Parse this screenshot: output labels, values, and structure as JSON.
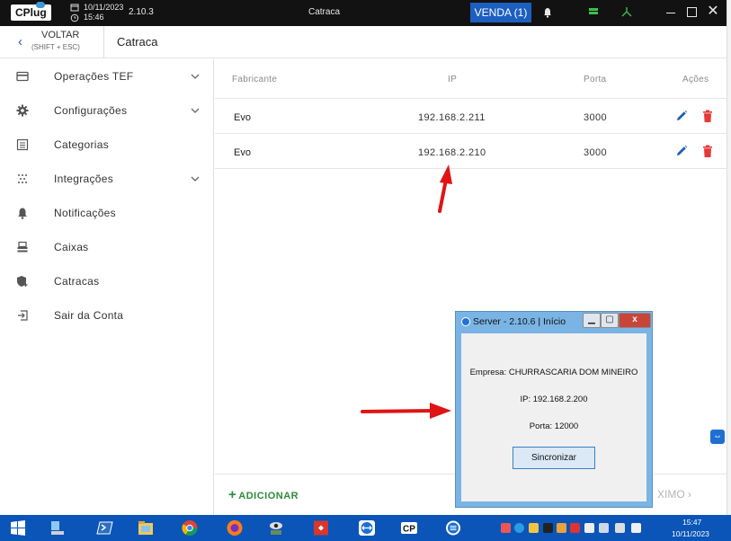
{
  "titlebar": {
    "app_name": "CPlug",
    "date": "10/11/2023",
    "time": "15:46",
    "version": "2.10.3",
    "title": "Catraca",
    "venda_label": "VENDA (1)"
  },
  "header": {
    "back_label": "VOLTAR",
    "back_shortcut": "(SHIFT + ESC)",
    "page_title": "Catraca"
  },
  "sidebar": {
    "items": [
      {
        "label": "Operações TEF",
        "icon": "card-icon",
        "expandable": true
      },
      {
        "label": "Configurações",
        "icon": "gear-icon",
        "expandable": true
      },
      {
        "label": "Categorias",
        "icon": "list-icon",
        "expandable": false
      },
      {
        "label": "Integrações",
        "icon": "dots-icon",
        "expandable": true
      },
      {
        "label": "Notificações",
        "icon": "bell-icon",
        "expandable": false
      },
      {
        "label": "Caixas",
        "icon": "register-icon",
        "expandable": false
      },
      {
        "label": "Catracas",
        "icon": "shield-plus-icon",
        "expandable": false
      },
      {
        "label": "Sair da Conta",
        "icon": "exit-icon",
        "expandable": false
      }
    ]
  },
  "table": {
    "columns": [
      "Fabricante",
      "IP",
      "Porta",
      "Ações"
    ],
    "rows": [
      {
        "fabricante": "Evo",
        "ip": "192.168.2.211",
        "porta": "3000"
      },
      {
        "fabricante": "Evo",
        "ip": "192.168.2.210",
        "porta": "3000"
      }
    ]
  },
  "footer": {
    "add_label": "ADICIONAR",
    "next_label": "XIMO ›"
  },
  "server_window": {
    "title": "Server - 2.10.6 | Início",
    "empresa": "Empresa: CHURRASCARIA DOM MINEIRO",
    "ip": "IP: 192.168.2.200",
    "porta": "Porta: 12000",
    "sync_label": "Sincronizar"
  },
  "taskbar": {
    "time": "15:47",
    "date": "10/11/2023"
  },
  "colors": {
    "accent_blue": "#1d5fc0",
    "add_green": "#2e8b3a",
    "delete_red": "#e53935",
    "edit_blue": "#1f5db8",
    "annotation_red": "#e01414"
  }
}
